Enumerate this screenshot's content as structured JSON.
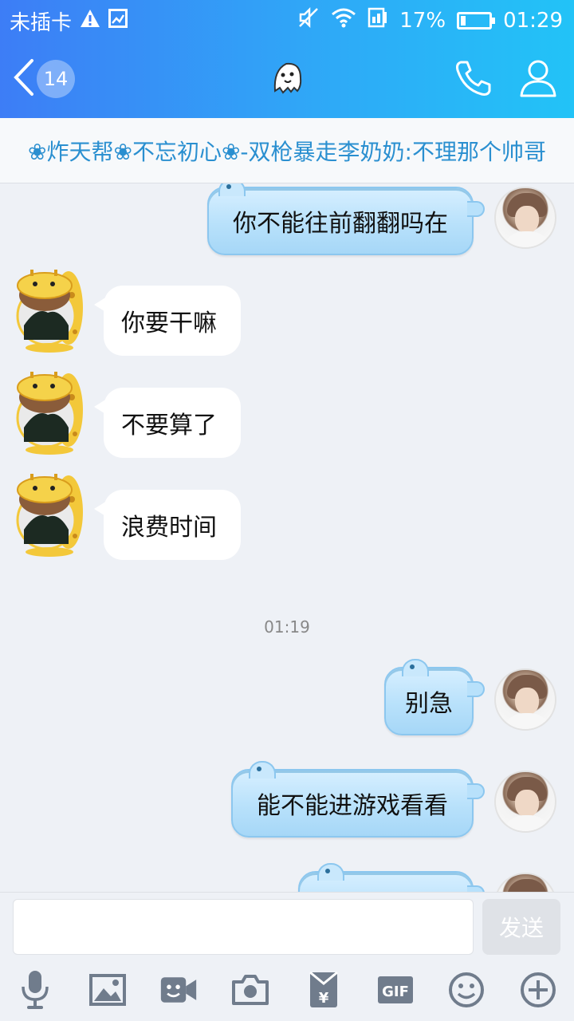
{
  "status_bar": {
    "carrier": "未插卡",
    "battery_percent": "17%",
    "battery_level": 0.17,
    "time": "01:29",
    "icons": [
      "warning-icon",
      "image-notification-icon",
      "mute-icon",
      "wifi-icon",
      "data-icon"
    ]
  },
  "header": {
    "back_badge": "14",
    "center_icon": "ghost-icon",
    "call_icon": "phone-icon",
    "profile_icon": "person-icon"
  },
  "group_title": "❀炸天帮❀不忘初心❀-双枪暴走李奶奶:不理那个帅哥",
  "messages": [
    {
      "side": "right",
      "text": "你不能往前翻翻吗在"
    },
    {
      "side": "left",
      "text": "你要干嘛"
    },
    {
      "side": "left",
      "text": "不要算了"
    },
    {
      "side": "left",
      "text": "浪费时间"
    },
    {
      "side": "right",
      "text": "别急"
    },
    {
      "side": "right",
      "text": "能不能进游戏看看"
    },
    {
      "side": "right",
      "text": ""
    }
  ],
  "timestamp": "01:19",
  "input": {
    "placeholder": "",
    "value": "",
    "send_label": "发送"
  },
  "toolbar": {
    "items": [
      "microphone-icon",
      "image-icon",
      "video-call-icon",
      "camera-icon",
      "red-packet-icon",
      "gif-icon",
      "emoji-icon",
      "plus-icon"
    ],
    "gif_label": "GIF",
    "yuan_label": "¥"
  },
  "colors": {
    "header_gradient_start": "#3d7df6",
    "header_gradient_end": "#22c3f7",
    "group_title": "#2a8fd0",
    "bubble_right": "#b8e1fb",
    "bubble_left": "#ffffff"
  }
}
